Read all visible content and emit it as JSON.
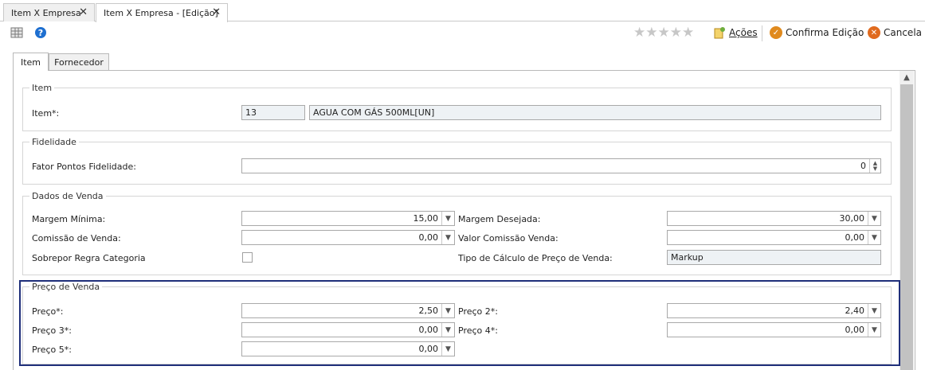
{
  "doc_tabs": [
    {
      "label": "Item X Empresa"
    },
    {
      "label": "Item X Empresa - [Edição]"
    }
  ],
  "toolbar": {
    "stars": "★★★★★",
    "acoes_label": "Ações",
    "confirma_label": "Confirma Edição",
    "cancela_label": "Cancela"
  },
  "inner_tabs": [
    {
      "label": "Item"
    },
    {
      "label": "Fornecedor"
    }
  ],
  "groups": {
    "item": {
      "title": "Item",
      "item_label": "Item*:",
      "item_code": "13",
      "item_desc": "AGUA COM GÁS 500ML[UN]"
    },
    "fidelidade": {
      "title": "Fidelidade",
      "fator_label": "Fator Pontos Fidelidade:",
      "fator_value": "0"
    },
    "dados_venda": {
      "title": "Dados de Venda",
      "margem_minima_label": "Margem Mínima:",
      "margem_minima_value": "15,00",
      "margem_desejada_label": "Margem Desejada:",
      "margem_desejada_value": "30,00",
      "comissao_label": "Comissão de Venda:",
      "comissao_value": "0,00",
      "valor_comissao_label": "Valor Comissão Venda:",
      "valor_comissao_value": "0,00",
      "sobrepor_label": "Sobrepor Regra Categoria",
      "sobrepor_checked": false,
      "tipo_calculo_label": "Tipo de Cálculo de Preço de Venda:",
      "tipo_calculo_value": "Markup"
    },
    "preco_venda": {
      "title": "Preço de Venda",
      "preco1_label": "Preço*:",
      "preco1_value": "2,50",
      "preco2_label": "Preço 2*:",
      "preco2_value": "2,40",
      "preco3_label": "Preço 3*:",
      "preco3_value": "0,00",
      "preco4_label": "Preço 4*:",
      "preco4_value": "0,00",
      "preco5_label": "Preço 5*:",
      "preco5_value": "0,00"
    }
  },
  "colors": {
    "highlight_border": "#1f2f7a",
    "confirm_icon": "#e08a1e",
    "cancel_icon": "#e06a1e",
    "help_icon": "#1e6fd0"
  }
}
